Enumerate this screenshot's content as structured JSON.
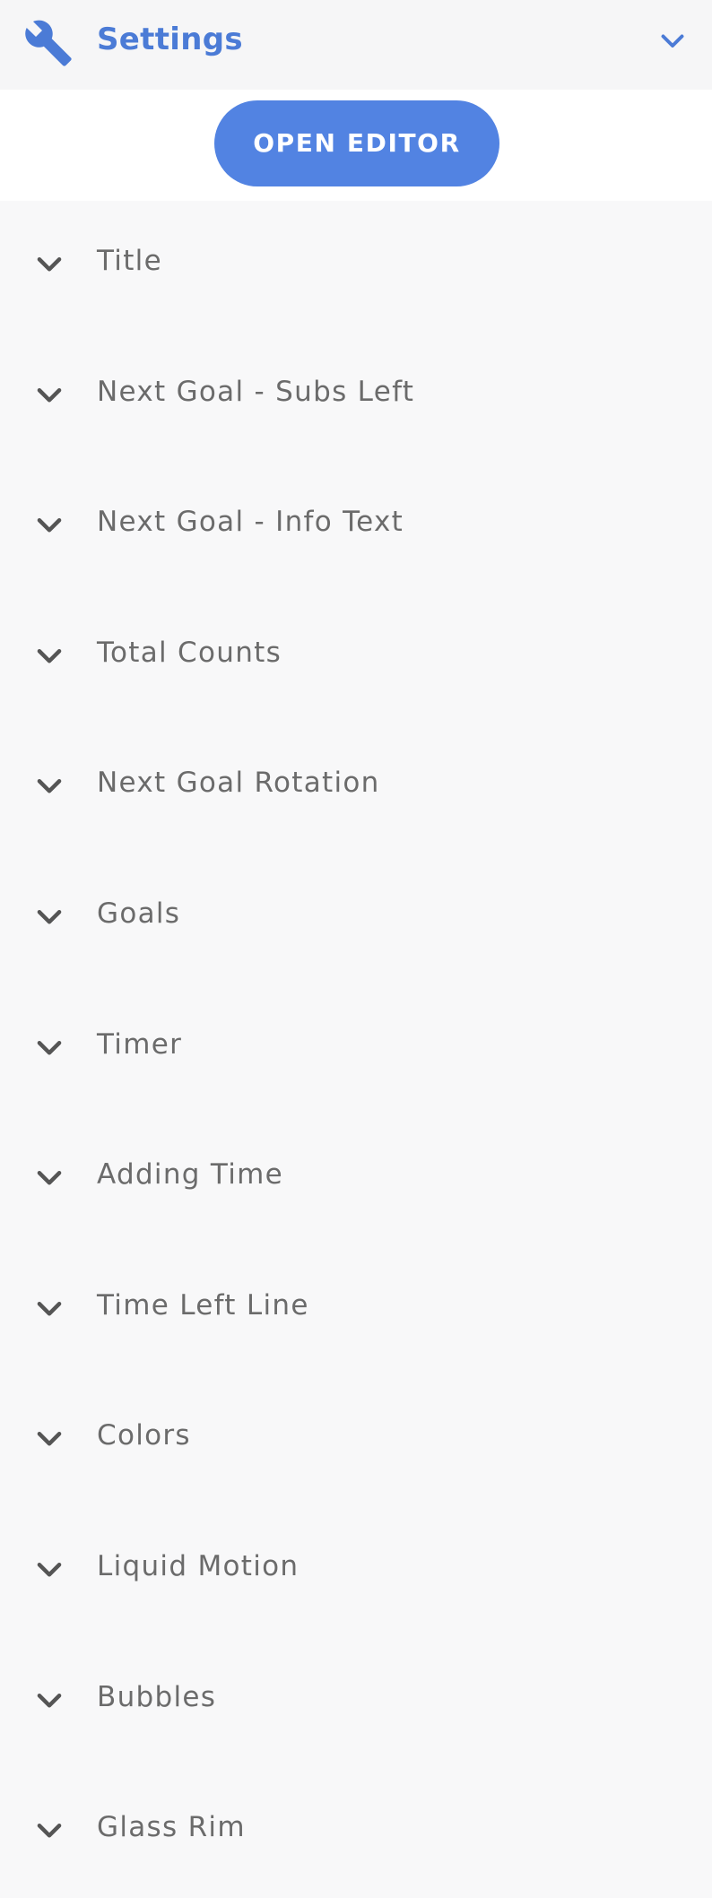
{
  "header": {
    "title": "Settings",
    "icon": "wrench-icon",
    "collapse_icon": "chevron-down-icon",
    "accent_color": "#4b7bd6"
  },
  "editor": {
    "button_label": "OPEN EDITOR",
    "button_color": "#5283e2"
  },
  "sections": [
    {
      "label": "Title"
    },
    {
      "label": "Next Goal - Subs Left"
    },
    {
      "label": "Next Goal - Info Text"
    },
    {
      "label": "Total Counts"
    },
    {
      "label": "Next Goal Rotation"
    },
    {
      "label": "Goals"
    },
    {
      "label": "Timer"
    },
    {
      "label": "Adding Time"
    },
    {
      "label": "Time Left Line"
    },
    {
      "label": "Colors"
    },
    {
      "label": "Liquid Motion"
    },
    {
      "label": "Bubbles"
    },
    {
      "label": "Glass Rim"
    }
  ],
  "section_icon": "chevron-down-icon",
  "text_color": "#6b6b6b"
}
